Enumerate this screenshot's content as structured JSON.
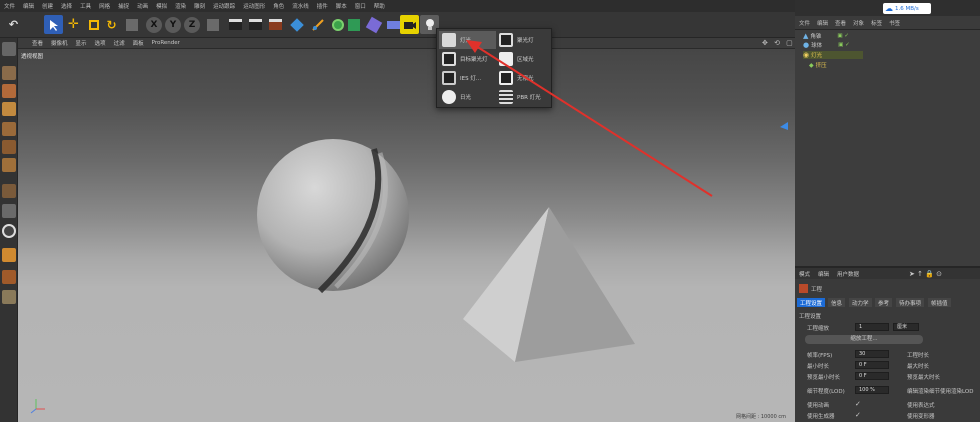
{
  "menubar": [
    "文件",
    "编辑",
    "创建",
    "选择",
    "工具",
    "网格",
    "捕捉",
    "动画",
    "模拟",
    "渲染",
    "雕刻",
    "运动跟踪",
    "运动图形",
    "角色",
    "流水线",
    "插件",
    "脚本",
    "窗口",
    "帮助"
  ],
  "toolbar": {
    "undo_icon": "undo-icon",
    "axis_x": "X",
    "axis_y": "Y",
    "axis_z": "Z"
  },
  "viewport": {
    "menu": [
      "查看",
      "摄像机",
      "显示",
      "选项",
      "过滤",
      "面板",
      "ProRender"
    ],
    "label": "透视视图",
    "footer": "网格间距 : 10000 cm"
  },
  "popup": {
    "items": [
      "灯光",
      "聚光灯",
      "目标聚光灯",
      "区域光",
      "IES 灯...",
      "无限光",
      "日光",
      "PBR 灯光"
    ]
  },
  "network_badge": "1.6 MB/s",
  "objects_panel": {
    "menu": [
      "文件",
      "编辑",
      "查看",
      "对象",
      "标签",
      "书签"
    ],
    "items": [
      "角锥",
      "球体",
      "灯光",
      "挤压"
    ]
  },
  "attributes": {
    "menu": [
      "模式",
      "编辑",
      "用户数据"
    ],
    "title": "工程",
    "tabs": [
      "工程设置",
      "信息",
      "动力学",
      "参考",
      "待办事项",
      "帧插值"
    ],
    "section": "工程设置",
    "scale_label": "工程缩放",
    "scale_value": "1",
    "scale_unit": "厘米",
    "scale_button": "缩放工程...",
    "left_fields": [
      {
        "label": "帧率(FPS)",
        "value": "30"
      },
      {
        "label": "最小时长",
        "value": "0 F"
      },
      {
        "label": "预览最小时长",
        "value": "0 F"
      },
      {
        "label": "细节程度(LOD)",
        "value": "100 %"
      },
      {
        "label": "使用动画",
        "value": "✓"
      },
      {
        "label": "使用生成器",
        "value": "✓"
      }
    ],
    "right_fields": [
      "工程时长",
      "最大时长",
      "预览最大时长",
      "编辑渲染细节使用渲染LOD",
      "使用表达式",
      "使用变形器"
    ]
  },
  "colors": {
    "accent_blue": "#1c6bd6",
    "arrow_red": "#e0312b",
    "viewport_bg": "#8c8c8c"
  }
}
